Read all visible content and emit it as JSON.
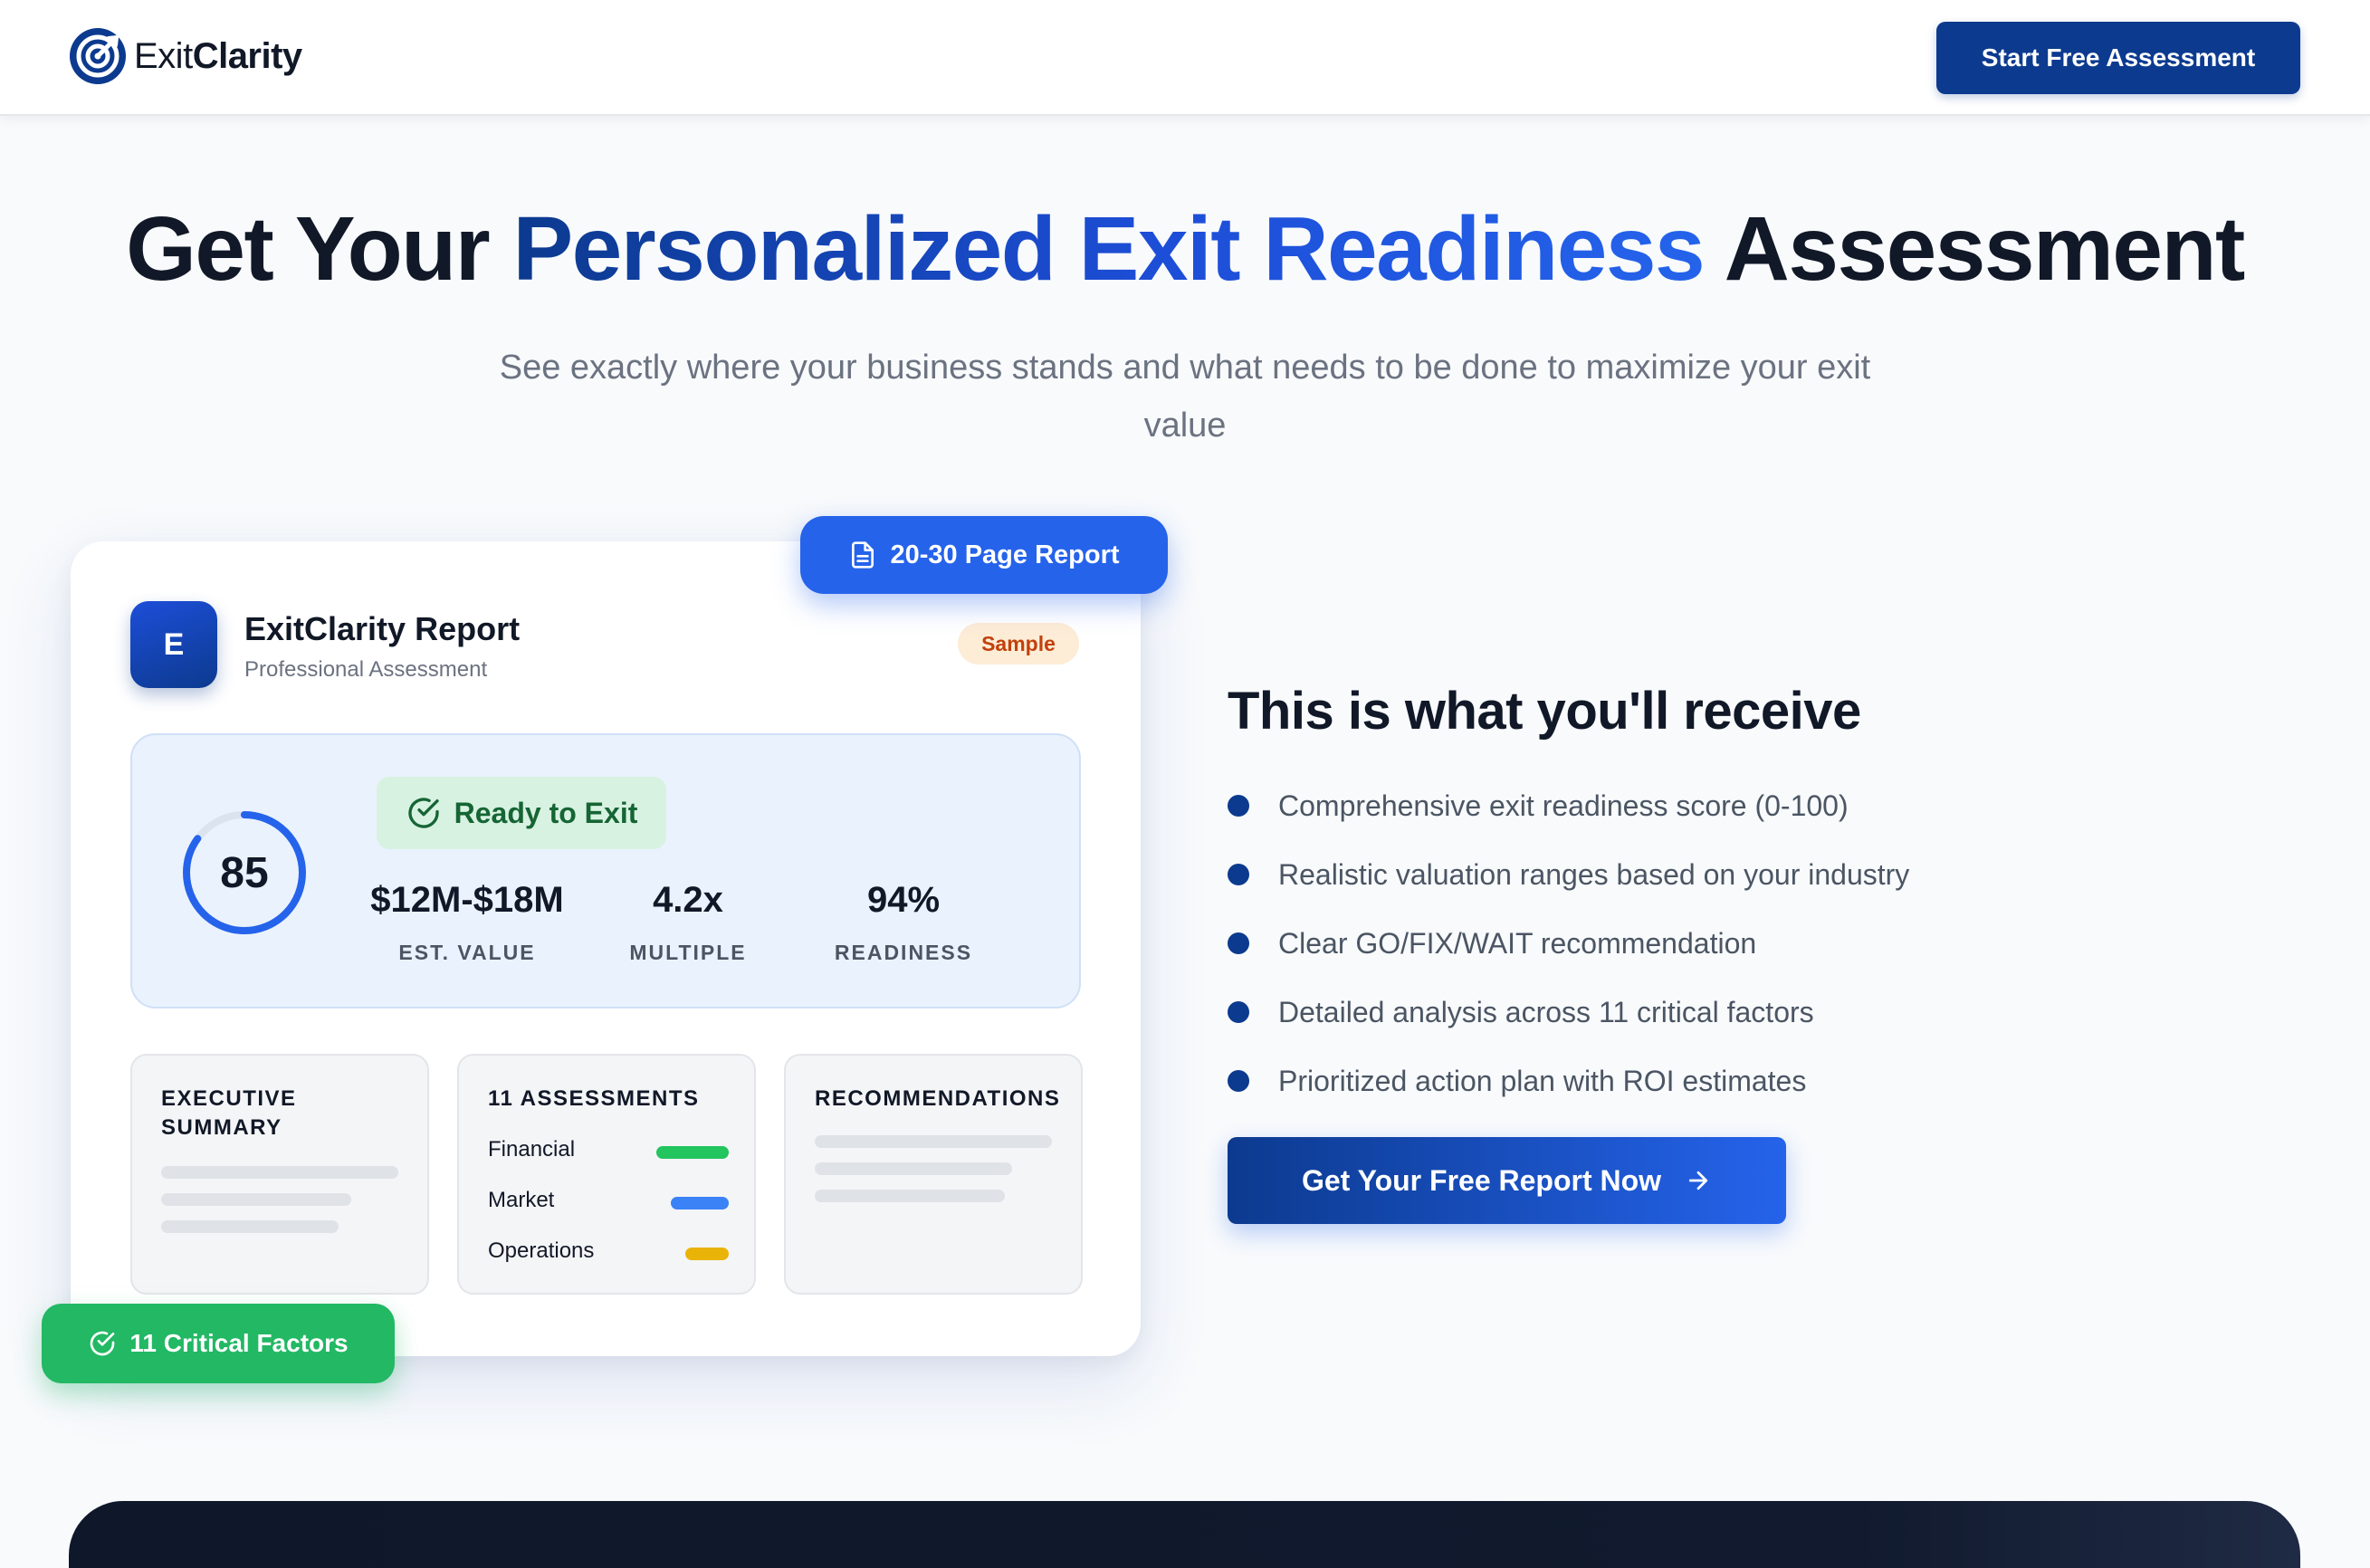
{
  "header": {
    "logo_light": "Exit",
    "logo_bold": "Clarity",
    "cta_label": "Start Free Assessment"
  },
  "hero": {
    "title_part1": "Get Your ",
    "title_highlight": "Personalized Exit Readiness",
    "title_part2": " Assessment",
    "subtitle": "See exactly where your business stands and what needs to be done to maximize your exit value"
  },
  "report_card": {
    "floating_badge": "20-30 Page Report",
    "avatar_letter": "E",
    "title": "ExitClarity Report",
    "subtitle": "Professional Assessment",
    "sample_label": "Sample",
    "score": "85",
    "score_fraction": 0.85,
    "status": "Ready to Exit",
    "metrics": [
      {
        "value": "$12M-$18M",
        "label": "EST. VALUE"
      },
      {
        "value": "4.2x",
        "label": "MULTIPLE"
      },
      {
        "value": "94%",
        "label": "READINESS"
      }
    ],
    "sections": {
      "summary_title": "EXECUTIVE SUMMARY",
      "assessments_title": "11 ASSESSMENTS",
      "assessments": [
        {
          "name": "Financial",
          "color": "#22c55e"
        },
        {
          "name": "Market",
          "color": "#3b82f6"
        },
        {
          "name": "Operations",
          "color": "#eab308"
        }
      ],
      "recommendations_title": "RECOMMENDATIONS"
    },
    "critical_badge": "11 Critical Factors"
  },
  "receive": {
    "title": "This is what you'll receive",
    "items": [
      "Comprehensive exit readiness score (0-100)",
      "Realistic valuation ranges based on your industry",
      "Clear GO/FIX/WAIT recommendation",
      "Detailed analysis across 11 critical factors",
      "Prioritized action plan with ROI estimates"
    ],
    "cta_label": "Get Your Free Report Now"
  },
  "colors": {
    "brand_navy": "#0c3a8f",
    "brand_blue": "#2563eb",
    "success_green": "#22b864"
  }
}
